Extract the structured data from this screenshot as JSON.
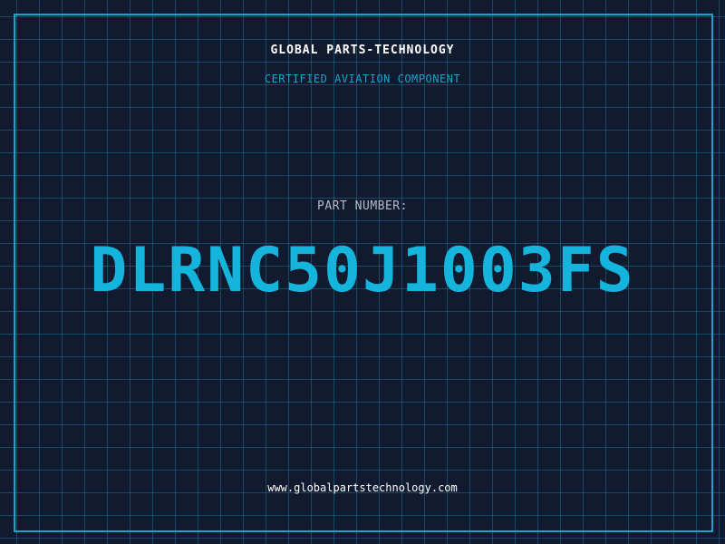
{
  "header": {
    "company_name": "GLOBAL PARTS-TECHNOLOGY",
    "tagline": "CERTIFIED AVIATION COMPONENT"
  },
  "part": {
    "label": "PART NUMBER:",
    "number": "DLRNC50J1003FS"
  },
  "footer": {
    "website": "www.globalpartstechnology.com"
  },
  "colors": {
    "background": "#111a2e",
    "grid": "#1e6e8c",
    "accent": "#1aa3cc",
    "part_number": "#14b4dc",
    "text": "#ffffff"
  }
}
